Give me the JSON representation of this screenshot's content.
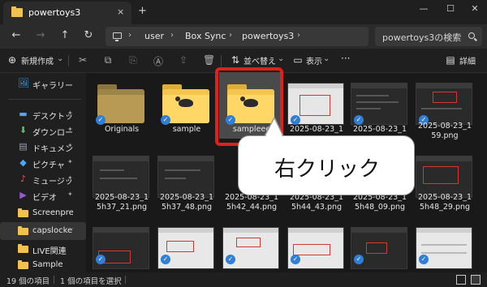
{
  "window": {
    "tab_title": "powertoys3",
    "tab_close_icon": "×",
    "new_tab_icon": "+",
    "minimize_icon": "—",
    "maximize_icon": "☐",
    "close_icon": "✕"
  },
  "address": {
    "back_icon": "←",
    "forward_icon": "→",
    "up_icon": "↑",
    "refresh_icon": "↻",
    "breadcrumbs": [
      "user",
      "Box Sync",
      "powertoys3"
    ],
    "separator": "›",
    "search_placeholder": "powertoys3の検索"
  },
  "commandbar": {
    "new_label": "新規作成",
    "sort_label": "並べ替え",
    "view_label": "表示",
    "more_label": "···",
    "details_label": "詳細",
    "icons": {
      "new": "⊕",
      "cut": "✂",
      "copy": "⧉",
      "paste": "⎘",
      "rename": "Ⓐ",
      "share": "⇪",
      "delete": "🗑",
      "sort": "⇅",
      "view": "▭",
      "details": "▤"
    }
  },
  "sidebar": {
    "items": [
      {
        "label": "ギャラリー",
        "icon": "🖼",
        "color": "#4ea3e6",
        "pinned": false
      },
      {
        "label": "デスクトップ",
        "icon": "▬",
        "color": "#4aa8ff",
        "pinned": true
      },
      {
        "label": "ダウンロード",
        "icon": "⬇",
        "color": "#5bc06a",
        "pinned": true
      },
      {
        "label": "ドキュメント",
        "icon": "▤",
        "color": "#9aa4ae",
        "pinned": true
      },
      {
        "label": "ピクチャ",
        "icon": "◆",
        "color": "#4aa8ff",
        "pinned": true
      },
      {
        "label": "ミュージック",
        "icon": "♪",
        "color": "#e0605a",
        "pinned": true
      },
      {
        "label": "ビデオ",
        "icon": "▶",
        "color": "#9b59d0",
        "pinned": true
      },
      {
        "label": "Screenpresso",
        "icon": "folder",
        "color": "#f2c14e",
        "pinned": false
      },
      {
        "label": "capslocketc",
        "icon": "folder",
        "color": "#f2c14e",
        "pinned": false,
        "selected": true
      },
      {
        "label": "LIVE関連",
        "icon": "folder",
        "color": "#f2c14e",
        "pinned": false
      },
      {
        "label": "Sample",
        "icon": "folder",
        "color": "#f2c14e",
        "pinned": false
      }
    ]
  },
  "files": [
    {
      "label1": "Originals",
      "label2": "",
      "kind": "folder-dim"
    },
    {
      "label1": "sample",
      "label2": "",
      "kind": "folder"
    },
    {
      "label1": "sampleee",
      "label2": "",
      "kind": "folder-selected"
    },
    {
      "label1": "2025-08-23_1",
      "label2": "",
      "kind": "image"
    },
    {
      "label1": "2025-08-23_1",
      "label2": "",
      "kind": "image"
    },
    {
      "label1": "2025-08-23_1",
      "label2": "59.png",
      "kind": "image"
    },
    {
      "label1": "2025-08-23_1",
      "label2": "5h37_21.png",
      "kind": "image"
    },
    {
      "label1": "2025-08-23_1",
      "label2": "5h37_48.png",
      "kind": "image"
    },
    {
      "label1": "2025-08-23_1",
      "label2": "5h42_44.png",
      "kind": "image"
    },
    {
      "label1": "2025-08-23_1",
      "label2": "5h44_43.png",
      "kind": "image"
    },
    {
      "label1": "2025-08-23_1",
      "label2": "5h48_09.png",
      "kind": "image"
    },
    {
      "label1": "2025-08-23_1",
      "label2": "5h48_29.png",
      "kind": "image"
    },
    {
      "label1": "",
      "label2": "",
      "kind": "image"
    },
    {
      "label1": "",
      "label2": "",
      "kind": "image"
    },
    {
      "label1": "",
      "label2": "",
      "kind": "image"
    },
    {
      "label1": "",
      "label2": "",
      "kind": "image"
    },
    {
      "label1": "",
      "label2": "",
      "kind": "image"
    },
    {
      "label1": "",
      "label2": "",
      "kind": "image"
    }
  ],
  "callout": {
    "text": "右クリック"
  },
  "status": {
    "item_count": "19 個の項目",
    "selected_count": "1 個の項目を選択"
  },
  "colors": {
    "highlight_red": "#e0201a",
    "check_blue": "#2f7fd6",
    "folder_yellow": "#ffd766"
  }
}
